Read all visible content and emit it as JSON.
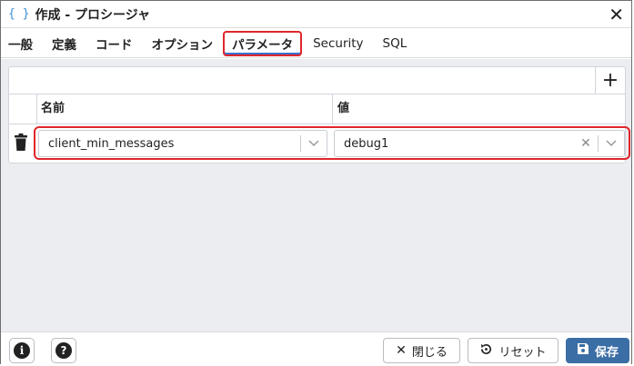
{
  "title_icon": "{ }",
  "title": "作成 - プロシージャ",
  "tabs": [
    {
      "label": "一般"
    },
    {
      "label": "定義"
    },
    {
      "label": "コード"
    },
    {
      "label": "オプション"
    },
    {
      "label": "パラメータ"
    },
    {
      "label": "Security"
    },
    {
      "label": "SQL"
    }
  ],
  "grid": {
    "columns": [
      "名前",
      "値"
    ],
    "rows": [
      {
        "name": "client_min_messages",
        "value": "debug1"
      }
    ]
  },
  "footer": {
    "close_label": "閉じる",
    "reset_label": "リセット",
    "save_label": "保存"
  },
  "colors": {
    "highlight": "#e0262b",
    "save_bg": "#3b6ea5",
    "content_bg": "#ebedf1"
  }
}
